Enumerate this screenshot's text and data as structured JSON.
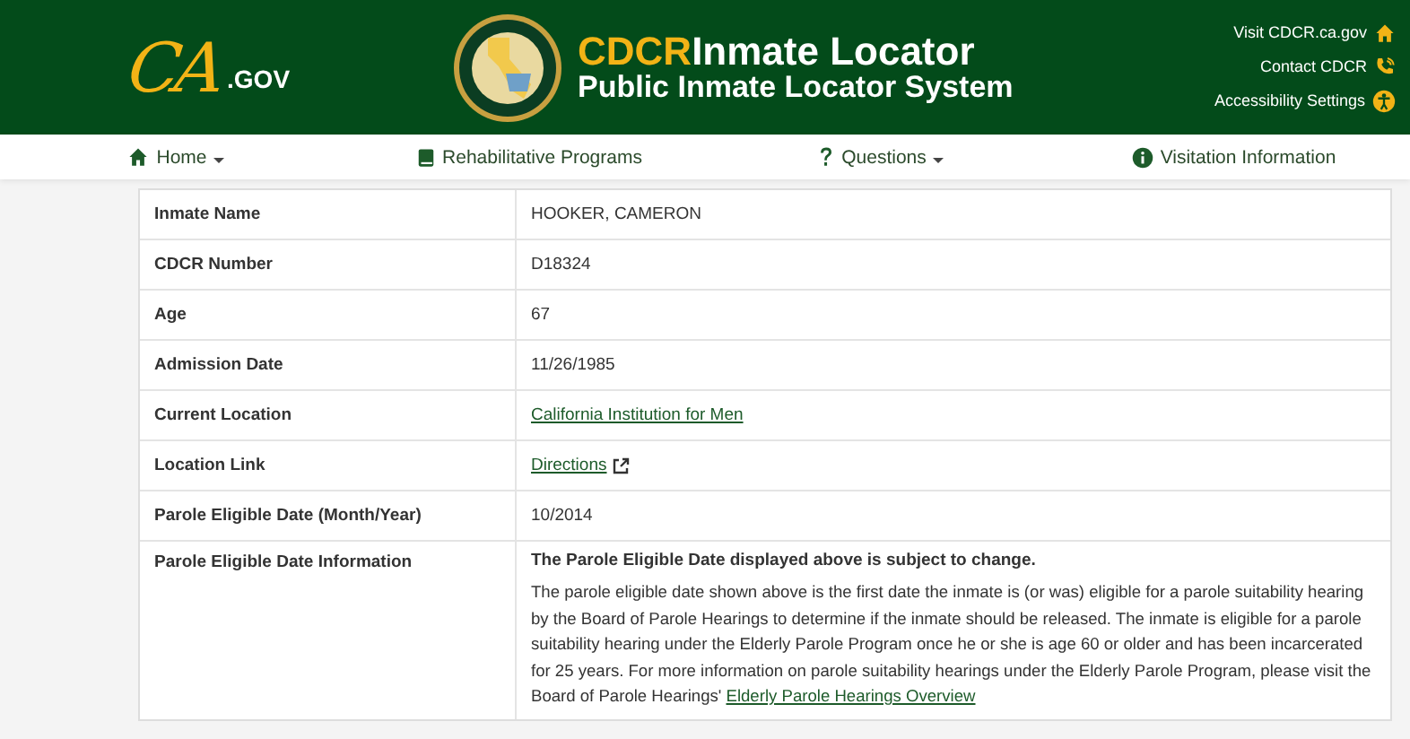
{
  "header": {
    "logo": {
      "ca": "CA",
      "suffix": ".GOV"
    },
    "title_accent": "CDCR",
    "title": "Inmate Locator",
    "subtitle": "Public Inmate Locator System",
    "links": [
      {
        "label": "Visit CDCR.ca.gov"
      },
      {
        "label": "Contact CDCR"
      },
      {
        "label": "Accessibility Settings"
      }
    ]
  },
  "nav": [
    {
      "label": "Home",
      "dropdown": true
    },
    {
      "label": "Rehabilitative Programs",
      "dropdown": false
    },
    {
      "label": "Questions",
      "dropdown": true
    },
    {
      "label": "Visitation Information",
      "dropdown": false
    }
  ],
  "details": [
    {
      "label": "Inmate Name",
      "kind": "text",
      "value": "HOOKER, CAMERON"
    },
    {
      "label": "CDCR Number",
      "kind": "text",
      "value": "D18324"
    },
    {
      "label": "Age",
      "kind": "text",
      "value": "67"
    },
    {
      "label": "Admission Date",
      "kind": "text",
      "value": "11/26/1985"
    },
    {
      "label": "Current Location",
      "kind": "link",
      "value": "California Institution for Men"
    },
    {
      "label": "Location Link",
      "kind": "external_link",
      "value": "Directions"
    },
    {
      "label": "Parole Eligible Date (Month/Year)",
      "kind": "text",
      "value": "10/2014"
    },
    {
      "label": "Parole Eligible Date Information",
      "kind": "note",
      "heading": "The Parole Eligible Date displayed above is subject to change.",
      "text": "The parole eligible date shown above is the first date the inmate is (or was) eligible for a parole suitability hearing by the Board of Parole Hearings to determine if the inmate should be released. The inmate is eligible for a parole suitability hearing under the Elderly Parole Program once he or she is age 60 or older and has been incarcerated for 25 years. For more information on parole suitability hearings under the Elderly Parole Program, please visit the Board of Parole Hearings'",
      "link": "Elderly Parole Hearings Overview"
    }
  ]
}
